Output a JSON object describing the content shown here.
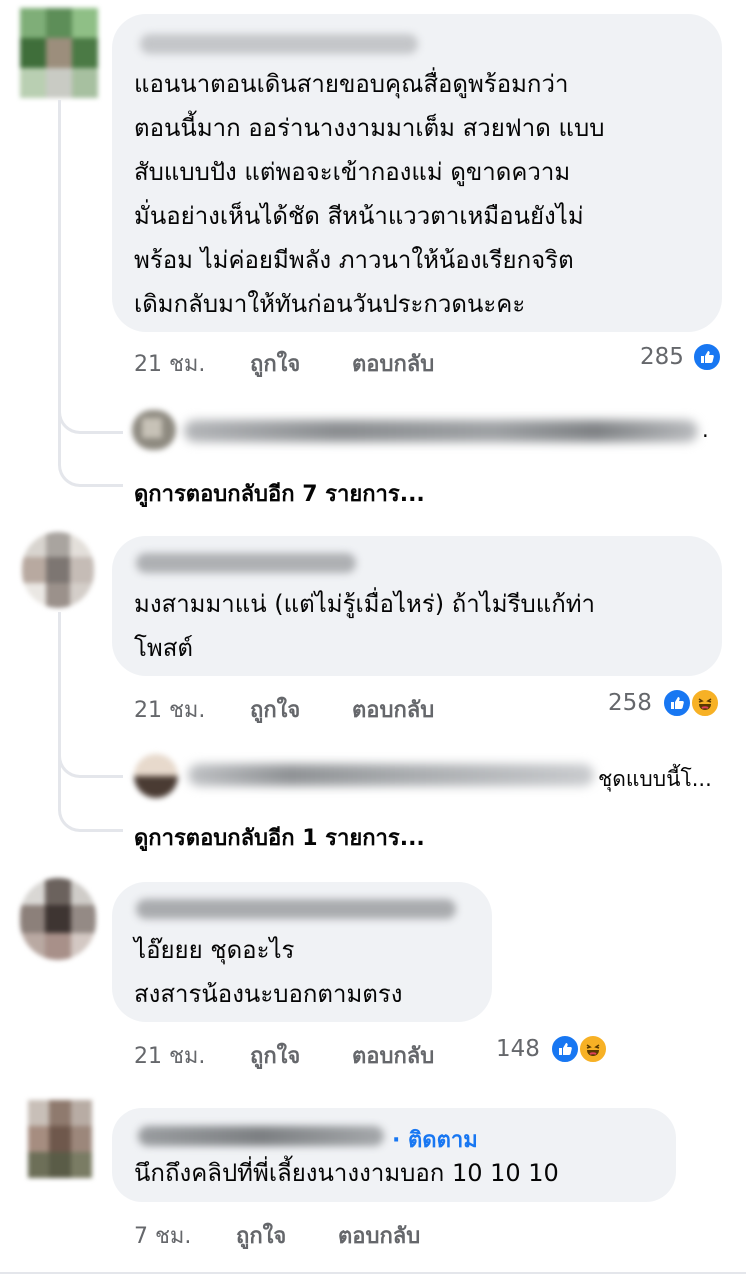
{
  "comments": [
    {
      "text_lines": [
        "แอนนาตอนเดินสายขอบคุณสื่อดูพร้อมกว่า",
        "ตอนนี้มาก ออร่านางงามมาเต็ม สวยฟาด แบบ",
        "สับแบบปัง  แต่พอจะเข้ากองแม่ ดูขาดความ",
        "มั่นอย่างเห็นได้ชัด สีหน้าแววตาเหมือนยังไม่",
        "พร้อม  ไม่ค่อยมีพลัง ภาวนาให้น้องเรียกจริต",
        "เดิมกลับมาให้ทันก่อนวันประกวดนะคะ"
      ],
      "time": "21 ชม.",
      "like_label": "ถูกใจ",
      "reply_label": "ตอบกลับ",
      "reaction_count": "285",
      "reactions": [
        "like-icon"
      ],
      "reply_preview_tail": ".",
      "more_replies": "ดูการตอบกลับอีก 7 รายการ..."
    },
    {
      "text_lines": [
        "มงสามมาแน่ (แต่ไม่รู้เมื่อไหร่) ถ้าไม่รีบแก้ท่า",
        "โพสต์"
      ],
      "time": "21 ชม.",
      "like_label": "ถูกใจ",
      "reply_label": "ตอบกลับ",
      "reaction_count": "258",
      "reactions": [
        "like-icon",
        "haha-icon"
      ],
      "reply_preview_tail": "ชุดแบบนี้โ...",
      "more_replies": "ดูการตอบกลับอีก 1 รายการ..."
    },
    {
      "text_lines": [
        "ไอ๊ยยย ชุดอะไร",
        "สงสารน้องนะบอกตามตรง"
      ],
      "time": "21 ชม.",
      "like_label": "ถูกใจ",
      "reply_label": "ตอบกลับ",
      "reaction_count": "148",
      "reactions": [
        "like-icon",
        "haha-icon"
      ]
    },
    {
      "follow_label": "· ติดตาม",
      "text_lines": [
        "นึกถึงคลิปที่พี่เลี้ยงนางงามบอก 10 10 10"
      ],
      "time": "7 ชม.",
      "like_label": "ถูกใจ",
      "reply_label": "ตอบกลับ"
    }
  ],
  "colors": {
    "bubble": "#f0f2f5",
    "meta_text": "#65676b",
    "like_blue": "#1877f2",
    "haha_yellow": "#f7b125",
    "thread_line": "#e4e6eb"
  }
}
